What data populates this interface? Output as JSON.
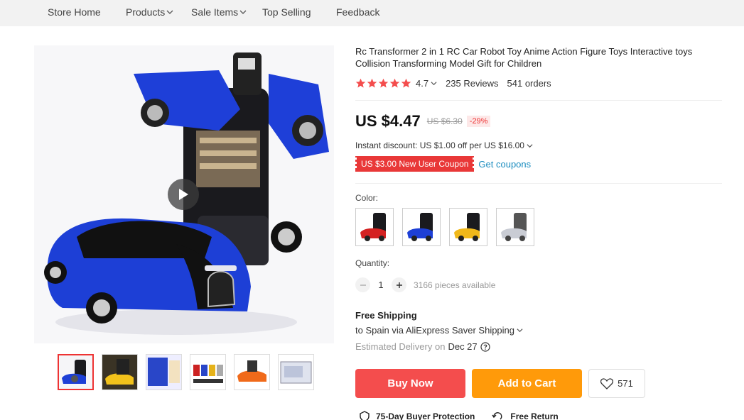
{
  "nav": {
    "store_home": "Store Home",
    "products": "Products",
    "sale_items": "Sale Items",
    "top_selling": "Top Selling",
    "feedback": "Feedback"
  },
  "product": {
    "title": "Rc Transformer 2 in 1 RC Car Robot Toy Anime Action Figure Toys Interactive toys Collision Transforming Model Gift for Children",
    "rating": "4.7",
    "reviews": "235 Reviews",
    "orders": "541 orders",
    "price": "US $4.47",
    "old_price": "US $6.30",
    "discount": "-29%",
    "instant_discount": "Instant discount: US $1.00 off per US $16.00",
    "coupon": "US $3.00 New User Coupon",
    "get_coupons": "Get coupons"
  },
  "options": {
    "color_label": "Color:",
    "colors": [
      "red",
      "blue",
      "yellow",
      "silver"
    ],
    "quantity_label": "Quantity:",
    "quantity": "1",
    "available": "3166 pieces available"
  },
  "shipping": {
    "title": "Free Shipping",
    "via": "to Spain via AliExpress Saver Shipping",
    "estimated_label": "Estimated Delivery on",
    "date": "Dec 27"
  },
  "actions": {
    "buy_now": "Buy Now",
    "add_to_cart": "Add to Cart",
    "wishlist_count": "571"
  },
  "protection": {
    "buyer": "75-Day Buyer Protection",
    "return": "Free Return"
  },
  "colors": {
    "accent_red": "#f44d4d",
    "accent_orange": "#ff9a0a",
    "link_blue": "#1a8cbf",
    "star": "#f44d4d"
  }
}
